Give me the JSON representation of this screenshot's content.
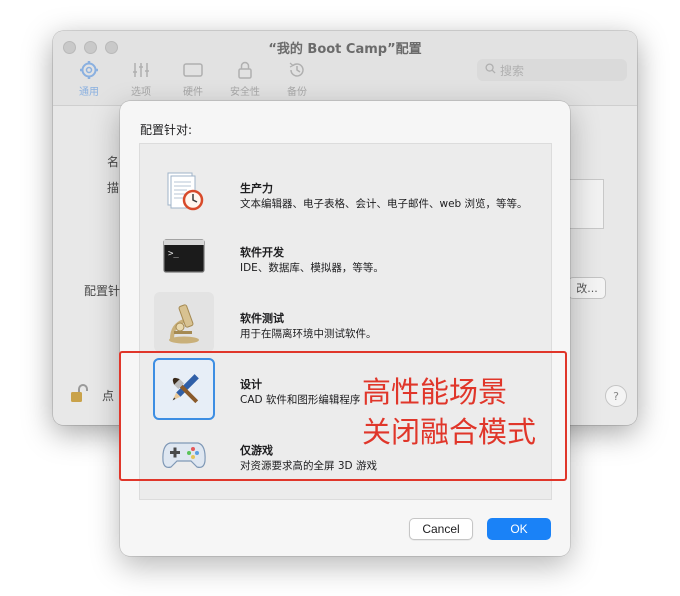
{
  "window": {
    "title": "“我的 Boot Camp”配置",
    "toolbar": [
      {
        "label": "通用",
        "icon": "gear-icon",
        "active": true
      },
      {
        "label": "选项",
        "icon": "sliders-icon",
        "active": false
      },
      {
        "label": "硬件",
        "icon": "display-icon",
        "active": false
      },
      {
        "label": "安全性",
        "icon": "lock-icon",
        "active": false
      },
      {
        "label": "备份",
        "icon": "clock-arrow-icon",
        "active": false
      }
    ],
    "search_placeholder": "搜索",
    "bg_labels": {
      "name": "名",
      "desc": "描",
      "config": "配置针",
      "lock_hint": "点",
      "change_button": "改..."
    },
    "help": "?"
  },
  "sheet": {
    "title": "配置针对:",
    "items": [
      {
        "name": "生产力",
        "desc": "文本编辑器、电子表格、会计、电子邮件、web 浏览，等等。",
        "icon": "document-clock-icon",
        "selected": false
      },
      {
        "name": "软件开发",
        "desc": "IDE、数据库、模拟器，等等。",
        "icon": "terminal-icon",
        "selected": false
      },
      {
        "name": "软件测试",
        "desc": "用于在隔离环境中测试软件。",
        "icon": "microscope-icon",
        "selected": false
      },
      {
        "name": "设计",
        "desc": "CAD 软件和图形编辑程序",
        "icon": "brush-pencil-icon",
        "selected": true
      },
      {
        "name": "仅游戏",
        "desc": "对资源要求高的全屏 3D 游戏",
        "icon": "gamepad-icon",
        "selected": false
      }
    ],
    "cancel_label": "Cancel",
    "ok_label": "OK"
  },
  "annotation": {
    "line1": "高性能场景",
    "line2": "关闭融合模式",
    "color": "#e0362a"
  },
  "colors": {
    "accent": "#1a82f7",
    "selection_border": "#3d8ee3"
  }
}
